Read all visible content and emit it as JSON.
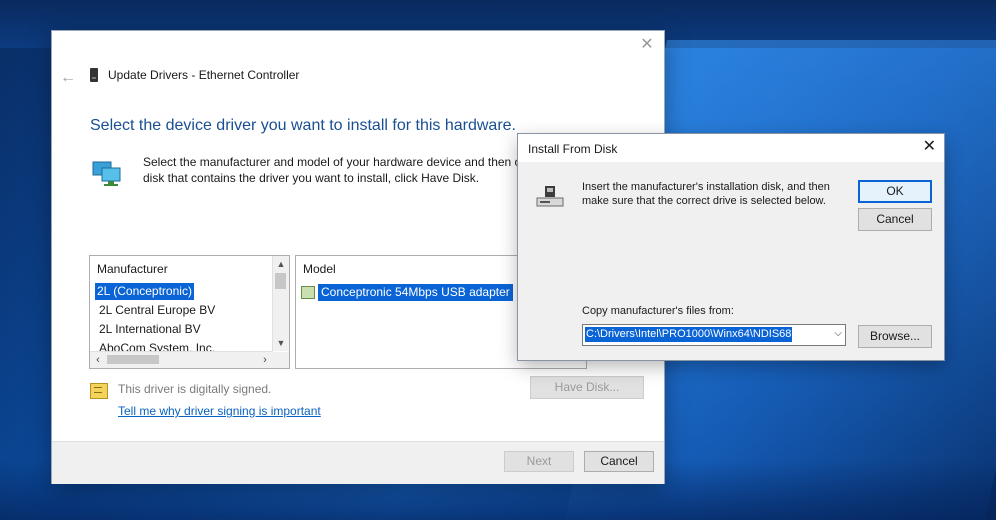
{
  "wizard": {
    "title": "Update Drivers - Ethernet Controller",
    "heading": "Select the device driver you want to install for this hardware.",
    "instruction_line1": "Select the manufacturer and model of your hardware device and then c",
    "instruction_line2": "disk that contains the driver you want to install, click Have Disk.",
    "manufacturer_header": "Manufacturer",
    "manufacturers": [
      "2L (Conceptronic)",
      "2L Central Europe BV",
      "2L International BV",
      "AboCom System, Inc."
    ],
    "selected_manufacturer_index": 0,
    "model_header": "Model",
    "models": [
      "Conceptronic 54Mbps USB adapter"
    ],
    "signed_text": "This driver is digitally signed.",
    "signing_link": "Tell me why driver signing is important",
    "have_disk_label": "Have Disk...",
    "next_label": "Next",
    "cancel_label": "Cancel"
  },
  "dialog": {
    "title": "Install From Disk",
    "instruction_line1": "Insert the manufacturer's installation disk, and then",
    "instruction_line2": "make sure that the correct drive is selected below.",
    "ok_label": "OK",
    "cancel_label": "Cancel",
    "copy_label": "Copy manufacturer's files from:",
    "path_value": "C:\\Drivers\\Intel\\PRO1000\\Winx64\\NDIS68",
    "browse_label": "Browse..."
  },
  "icons": {
    "back": "back-arrow-icon",
    "close": "close-icon",
    "device": "device-icon",
    "monitor": "network-monitor-icon",
    "signed": "signed-driver-icon",
    "disk": "disk-drive-icon"
  },
  "colors": {
    "selection": "#0a64d6",
    "heading": "#1a4f92",
    "link": "#0a62c0"
  }
}
